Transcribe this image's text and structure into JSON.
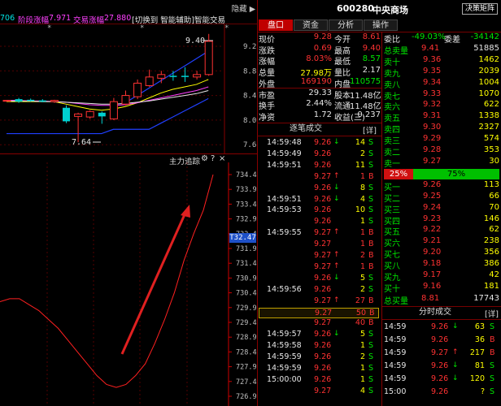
{
  "top_menu": "隐藏 ▶",
  "indicator_bar": {
    "prefix": "706",
    "stage_up_label": "阶段涨幅",
    "stage_up_value": "7.971",
    "trade_up_label": "交易涨幅",
    "trade_up_value": "27.880",
    "switch_btn": "[切换到 智能辅助]",
    "smart_trade": "智能交易"
  },
  "kline": {
    "price_labels": [
      "9.2",
      "8.8",
      "8.4",
      "8.0",
      "7.6"
    ],
    "high_label": "9.40",
    "low_label": "7.64",
    "candles": [
      {
        "o": 8.32,
        "c": 8.32,
        "h": 8.32,
        "l": 8.32
      },
      {
        "o": 8.34,
        "c": 8.3,
        "h": 8.36,
        "l": 8.28
      },
      {
        "o": 8.33,
        "c": 8.31,
        "h": 8.35,
        "l": 8.3
      },
      {
        "o": 8.32,
        "c": 8.3,
        "h": 8.34,
        "l": 8.29
      },
      {
        "o": 8.3,
        "c": 8.32,
        "h": 8.33,
        "l": 8.28
      },
      {
        "o": 8.2,
        "c": 7.98,
        "h": 8.24,
        "l": 7.95
      },
      {
        "o": 8.06,
        "c": 8.1,
        "h": 8.12,
        "l": 7.64
      },
      {
        "o": 8.05,
        "c": 8.14,
        "h": 8.16,
        "l": 8.02
      },
      {
        "o": 8.12,
        "c": 8.06,
        "h": 8.14,
        "l": 7.94
      },
      {
        "o": 8.02,
        "c": 8.3,
        "h": 8.36,
        "l": 8.0
      },
      {
        "o": 8.26,
        "c": 8.4,
        "h": 8.48,
        "l": 8.24
      },
      {
        "o": 8.38,
        "c": 8.6,
        "h": 8.66,
        "l": 8.34
      },
      {
        "o": 8.56,
        "c": 8.7,
        "h": 8.82,
        "l": 8.54
      },
      {
        "o": 8.68,
        "c": 8.74,
        "h": 8.8,
        "l": 8.6
      },
      {
        "o": 8.72,
        "c": 8.7,
        "h": 8.8,
        "l": 8.64
      },
      {
        "o": 8.72,
        "c": 8.7,
        "h": 8.86,
        "l": 8.62
      },
      {
        "o": 8.7,
        "c": 8.74,
        "h": 8.8,
        "l": 8.66
      },
      {
        "o": 8.74,
        "c": 9.28,
        "h": 9.4,
        "l": 8.72
      }
    ]
  },
  "lower_panel": {
    "title": "主力追踪",
    "axis_labels": [
      "734.4",
      "733.9",
      "733.4",
      "732.9",
      "732.4",
      "731.9",
      "731.4",
      "730.9",
      "730.4",
      "729.9",
      "729.4",
      "728.9",
      "728.4",
      "727.9",
      "727.4",
      "726.9"
    ],
    "current_badge": "T32.47",
    "curve": [
      730.1,
      730.2,
      730.2,
      730.0,
      729.8,
      729.5,
      729.2,
      728.8,
      728.4,
      728.0,
      727.6,
      727.3,
      727.2,
      727.3,
      727.6,
      728.0,
      728.7,
      729.5,
      730.4,
      731.5,
      732.4,
      733.2,
      734.4
    ]
  },
  "stock": {
    "code": "600280",
    "name": "中央商场",
    "decision_btn": "决策矩阵"
  },
  "tabs": [
    "盘口",
    "资金",
    "分析",
    "操作"
  ],
  "quote": {
    "rows": [
      [
        {
          "l": "现价",
          "v": "9.28",
          "vc": "r"
        },
        {
          "l": "今开",
          "v": "8.61",
          "vc": "r"
        }
      ],
      [
        {
          "l": "涨跌",
          "v": "0.69",
          "vc": "r"
        },
        {
          "l": "最高",
          "v": "9.40",
          "vc": "r"
        }
      ],
      [
        {
          "l": "涨幅",
          "v": "8.03%",
          "vc": "r"
        },
        {
          "l": "最低",
          "v": "8.57",
          "vc": "g"
        }
      ],
      [
        {
          "l": "总量",
          "v": "27.98万",
          "vc": "y"
        },
        {
          "l": "量比",
          "v": "2.17",
          "vc": "w"
        }
      ],
      [
        {
          "l": "外盘",
          "v": "169190",
          "vc": "r"
        },
        {
          "l": "内盘",
          "v": "110575",
          "vc": "g"
        }
      ],
      [
        {
          "l": "市盈",
          "v": "29.33",
          "vc": "w"
        },
        {
          "l": "股本",
          "v": "11.48亿",
          "vc": "w"
        }
      ],
      [
        {
          "l": "换手",
          "v": "2.44%",
          "vc": "w"
        },
        {
          "l": "流通",
          "v": "11.48亿",
          "vc": "w"
        }
      ],
      [
        {
          "l": "净资",
          "v": "1.72",
          "vc": "w"
        },
        {
          "l": "收益(三)",
          "v": "0.237",
          "vc": "w"
        }
      ]
    ],
    "trades_title": "逐笔成交",
    "detail_btn": "[详]"
  },
  "trades": [
    {
      "t": "14:59:48",
      "p": "9.26",
      "a": "down",
      "v": "14",
      "s": "S"
    },
    {
      "t": "14:59:49",
      "p": "9.26",
      "a": "",
      "v": "2",
      "s": "S"
    },
    {
      "t": "14:59:51",
      "p": "9.26",
      "a": "",
      "v": "11",
      "s": "S"
    },
    {
      "t": "",
      "p": "9.27",
      "a": "up",
      "v": "1",
      "s": "B"
    },
    {
      "t": "",
      "p": "9.26",
      "a": "down",
      "v": "8",
      "s": "S"
    },
    {
      "t": "14:59:51",
      "p": "9.26",
      "a": "down",
      "v": "4",
      "s": "S"
    },
    {
      "t": "14:59:53",
      "p": "9.26",
      "a": "",
      "v": "10",
      "s": "S"
    },
    {
      "t": "",
      "p": "9.26",
      "a": "",
      "v": "1",
      "s": "S"
    },
    {
      "t": "14:59:55",
      "p": "9.27",
      "a": "up",
      "v": "1",
      "s": "B"
    },
    {
      "t": "",
      "p": "9.27",
      "a": "",
      "v": "1",
      "s": "B"
    },
    {
      "t": "",
      "p": "9.27",
      "a": "up",
      "v": "2",
      "s": "B"
    },
    {
      "t": "",
      "p": "9.27",
      "a": "up",
      "v": "1",
      "s": "B"
    },
    {
      "t": "",
      "p": "9.26",
      "a": "down",
      "v": "5",
      "s": "S"
    },
    {
      "t": "14:59:56",
      "p": "9.26",
      "a": "",
      "v": "2",
      "s": "S"
    },
    {
      "t": "",
      "p": "9.27",
      "a": "up",
      "v": "27",
      "s": "B"
    },
    {
      "t": "",
      "p": "9.27",
      "a": "",
      "v": "50",
      "s": "B",
      "hl": true
    },
    {
      "t": "",
      "p": "9.27",
      "a": "",
      "v": "40",
      "s": "B"
    },
    {
      "t": "14:59:57",
      "p": "9.26",
      "a": "down",
      "v": "5",
      "s": "S"
    },
    {
      "t": "14:59:58",
      "p": "9.26",
      "a": "",
      "v": "1",
      "s": "S"
    },
    {
      "t": "14:59:59",
      "p": "9.26",
      "a": "",
      "v": "2",
      "s": "S"
    },
    {
      "t": "14:59:59",
      "p": "9.26",
      "a": "",
      "v": "1",
      "s": "S"
    },
    {
      "t": "15:00:00",
      "p": "9.26",
      "a": "",
      "v": "1",
      "s": "S"
    },
    {
      "t": "",
      "p": "9.27",
      "a": "",
      "v": "4",
      "s": "S"
    }
  ],
  "orderbook": {
    "wei_bi_label": "委比",
    "wei_bi": "-49.03%",
    "wei_cha_label": "委差",
    "wei_cha": "-34142",
    "total_sell_label": "总卖量",
    "total_sell_price": "9.41",
    "total_sell_vol": "51885",
    "sells": [
      {
        "l": "卖十",
        "p": "9.36",
        "v": "1462"
      },
      {
        "l": "卖九",
        "p": "9.35",
        "v": "2039"
      },
      {
        "l": "卖八",
        "p": "9.34",
        "v": "1004"
      },
      {
        "l": "卖七",
        "p": "9.33",
        "v": "1070"
      },
      {
        "l": "卖六",
        "p": "9.32",
        "v": "622"
      },
      {
        "l": "卖五",
        "p": "9.31",
        "v": "1338"
      },
      {
        "l": "卖四",
        "p": "9.30",
        "v": "2327"
      },
      {
        "l": "卖三",
        "p": "9.29",
        "v": "574"
      },
      {
        "l": "卖二",
        "p": "9.28",
        "v": "353"
      },
      {
        "l": "卖一",
        "p": "9.27",
        "v": "30"
      }
    ],
    "bar_left": "25%",
    "bar_right": "75%",
    "bar_left_fraction": 0.25,
    "buys": [
      {
        "l": "买一",
        "p": "9.26",
        "v": "113"
      },
      {
        "l": "买二",
        "p": "9.25",
        "v": "66"
      },
      {
        "l": "买三",
        "p": "9.24",
        "v": "70"
      },
      {
        "l": "买四",
        "p": "9.23",
        "v": "146"
      },
      {
        "l": "买五",
        "p": "9.22",
        "v": "62"
      },
      {
        "l": "买六",
        "p": "9.21",
        "v": "238"
      },
      {
        "l": "买七",
        "p": "9.20",
        "v": "356"
      },
      {
        "l": "买八",
        "p": "9.18",
        "v": "386"
      },
      {
        "l": "买九",
        "p": "9.17",
        "v": "42"
      },
      {
        "l": "买十",
        "p": "9.16",
        "v": "181"
      }
    ],
    "total_buy_label": "总买量",
    "total_buy_price": "8.81",
    "total_buy_vol": "17743"
  },
  "timeshare": {
    "title": "分时成交",
    "detail_btn": "[详]",
    "rows": [
      {
        "t": "14:59",
        "p": "9.26",
        "a": "down",
        "v": "63",
        "s": "S"
      },
      {
        "t": "14:59",
        "p": "9.26",
        "a": "",
        "v": "36",
        "s": "B"
      },
      {
        "t": "14:59",
        "p": "9.27",
        "a": "up",
        "v": "217",
        "s": "B"
      },
      {
        "t": "14:59",
        "p": "9.26",
        "a": "down",
        "v": "81",
        "s": "S"
      },
      {
        "t": "14:59",
        "p": "9.26",
        "a": "down",
        "v": "120",
        "s": "S"
      },
      {
        "t": "15:00",
        "p": "9.26",
        "a": "",
        "v": "?",
        "s": "S"
      }
    ]
  },
  "colors": {
    "up": "#ff3232",
    "down": "#00e600",
    "ma1": "#ffff00",
    "ma2": "#ff40ff",
    "ma3": "#e6e6e6",
    "band": "#2040ff",
    "accent": "#c00000"
  }
}
